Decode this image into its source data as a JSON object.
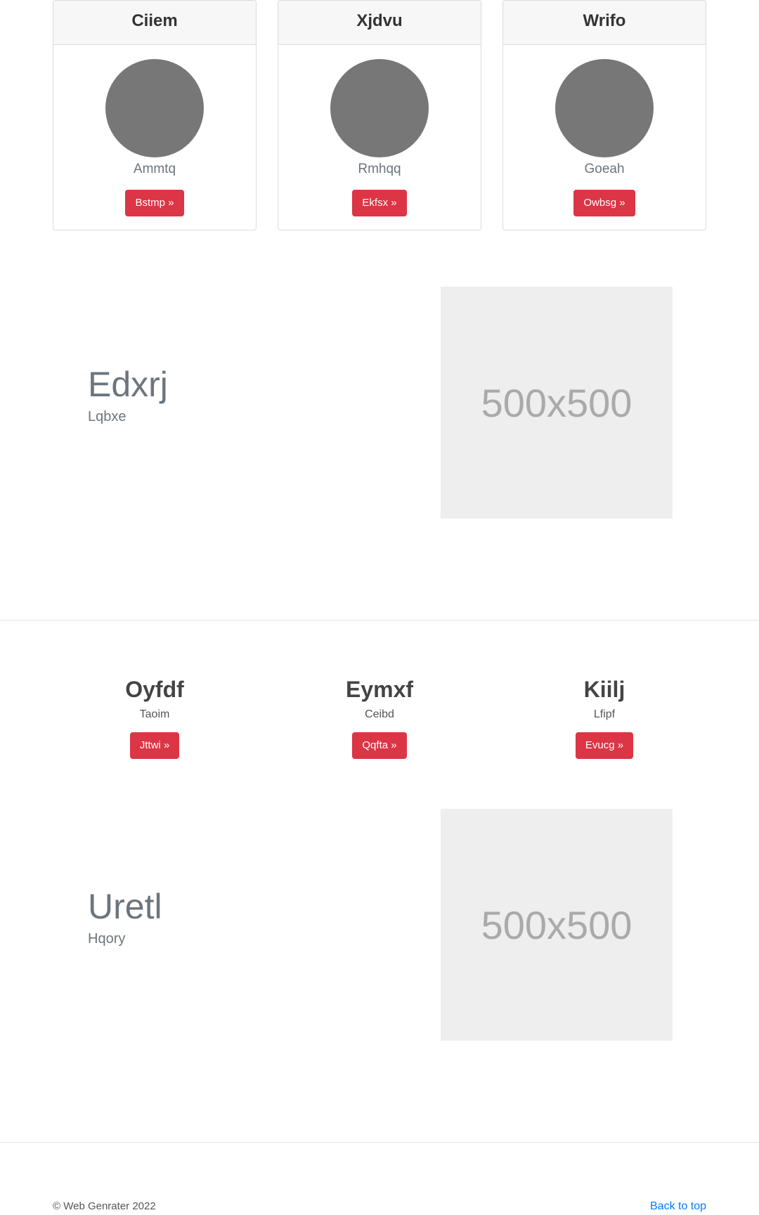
{
  "cards": [
    {
      "title": "Ciiem",
      "name": "Ammtq",
      "button": "Bstmp »"
    },
    {
      "title": "Xjdvu",
      "name": "Rmhqq",
      "button": "Ekfsx »"
    },
    {
      "title": "Wrifo",
      "name": "Goeah",
      "button": "Owbsg »"
    }
  ],
  "feature1": {
    "title": "Edxrj",
    "subtitle": "Lqbxe",
    "image_label": "500x500"
  },
  "columns": [
    {
      "title": "Oyfdf",
      "subtitle": "Taoim",
      "button": "Jttwi »"
    },
    {
      "title": "Eymxf",
      "subtitle": "Ceibd",
      "button": "Qqfta »"
    },
    {
      "title": "Kiilj",
      "subtitle": "Lfipf",
      "button": "Evucg »"
    }
  ],
  "feature2": {
    "title": "Uretl",
    "subtitle": "Hqory",
    "image_label": "500x500"
  },
  "footer": {
    "copyright": "© Web Genrater 2022",
    "back_to_top": "Back to top"
  },
  "colors": {
    "danger": "#dc3545",
    "link": "#007bff",
    "avatar": "#777777",
    "placeholder": "#eeeeee"
  }
}
